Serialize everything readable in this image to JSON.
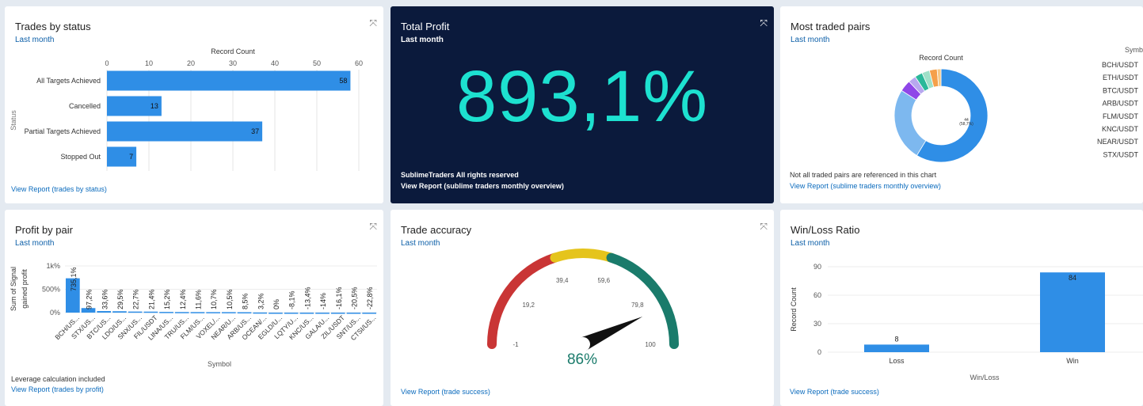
{
  "trades_by_status": {
    "title": "Trades by status",
    "subtitle": "Last month",
    "link": "View Report (trades by status)"
  },
  "total_profit": {
    "title": "Total Profit",
    "subtitle": "Last month",
    "value": "893,1%",
    "value_color": "#1de1d0",
    "footer": "SublimeTraders All rights reserved",
    "link": "View Report (sublime traders monthly overview)"
  },
  "most_traded_pairs": {
    "title": "Most traded pairs",
    "subtitle": "Last month",
    "note": "Not all traded pairs are referenced in this chart",
    "link": "View Report (sublime traders monthly overview)",
    "legend_header": "Symb",
    "center_label": "44",
    "center_pct": "(58,7%)"
  },
  "profit_by_pair": {
    "title": "Profit by pair",
    "subtitle": "Last month",
    "note": "Leverage calculation included",
    "link": "View Report (trades by profit)"
  },
  "trade_accuracy": {
    "title": "Trade accuracy",
    "subtitle": "Last month",
    "value": "86%",
    "link": "View Report (trade success)"
  },
  "win_loss": {
    "title": "Win/Loss Ratio",
    "subtitle": "Last month",
    "link": "View Report (trade success)"
  },
  "chart_data": [
    {
      "id": "trades-by-status",
      "type": "bar",
      "orientation": "horizontal",
      "title": "",
      "xlabel": "Record Count",
      "ylabel": "Status",
      "categories": [
        "All Targets Achieved",
        "Cancelled",
        "Partial Targets Achieved",
        "Stopped Out"
      ],
      "values": [
        58,
        13,
        37,
        7
      ],
      "xlim": [
        0,
        60
      ],
      "xticks": [
        0,
        10,
        20,
        30,
        40,
        50,
        60
      ],
      "color": "#2f8ee6"
    },
    {
      "id": "most-traded-pairs",
      "type": "pie",
      "donut": true,
      "title": "Record Count",
      "legend_placement": "right",
      "categories": [
        "BCH/USDT",
        "ETH/USDT",
        "BTC/USDT",
        "ARB/USDT",
        "FLM/USDT",
        "KNC/USDT",
        "NEAR/USDT",
        "STX/USDT"
      ],
      "values": [
        44,
        19,
        3,
        2,
        2,
        2,
        2,
        1
      ],
      "colors": [
        "#2f8ee6",
        "#7db8ef",
        "#8f47e8",
        "#b8a8ef",
        "#2bb89a",
        "#9fe0c8",
        "#f5a04a",
        "#f7c987"
      ]
    },
    {
      "id": "profit-by-pair",
      "type": "bar",
      "title": "",
      "xlabel": "Symbol",
      "ylabel": "Sum of Signal gained profit",
      "yticks": [
        "0%",
        "500%",
        "1k%"
      ],
      "ylim": [
        0,
        1000
      ],
      "categories": [
        "BCH/US...",
        "STX/US...",
        "BTC/US...",
        "LDO/US...",
        "SNX/US...",
        "FIL/USDT",
        "LINA/US...",
        "TRU/US...",
        "FLM/US...",
        "VOXEL/...",
        "NEAR/U...",
        "ARB/US...",
        "OCEAN/...",
        "EGLD/U...",
        "LQTY/U...",
        "KNC/US...",
        "GALA/U...",
        "ZIL/USDT",
        "SNT/US...",
        "CTSI/US..."
      ],
      "values": [
        735.1,
        97.2,
        33.6,
        29.5,
        22.7,
        21.4,
        15.2,
        12.4,
        11.6,
        10.7,
        10.5,
        8.5,
        3.2,
        0,
        -8.1,
        -13.4,
        -14,
        -16.1,
        -20.5,
        -22.8
      ],
      "labels": [
        "735,1%",
        "97,2%",
        "33,6%",
        "29,5%",
        "22,7%",
        "21,4%",
        "15,2%",
        "12,4%",
        "11,6%",
        "10,7%",
        "10,5%",
        "8,5%",
        "3,2%",
        "0%",
        "-8,1%",
        "-13,4%",
        "-14%",
        "-16,1%",
        "-20,5%",
        "-22,8%"
      ],
      "color": "#2f8ee6"
    },
    {
      "id": "trade-accuracy",
      "type": "gauge",
      "min": -1,
      "max": 100,
      "value": 86,
      "ticks": [
        "-1",
        "19,2",
        "39,4",
        "59,6",
        "79,8",
        "100"
      ],
      "bands": [
        {
          "from": -1,
          "to": 39.4,
          "color": "#c93535"
        },
        {
          "from": 39.4,
          "to": 59.6,
          "color": "#e5c41c"
        },
        {
          "from": 59.6,
          "to": 100,
          "color": "#1a7b6b"
        }
      ]
    },
    {
      "id": "win-loss",
      "type": "bar",
      "title": "",
      "xlabel": "Win/Loss",
      "ylabel": "Record Count",
      "categories": [
        "Loss",
        "Win"
      ],
      "values": [
        8,
        84
      ],
      "ylim": [
        0,
        90
      ],
      "yticks": [
        0,
        30,
        60,
        90
      ],
      "color": "#2f8ee6"
    }
  ]
}
